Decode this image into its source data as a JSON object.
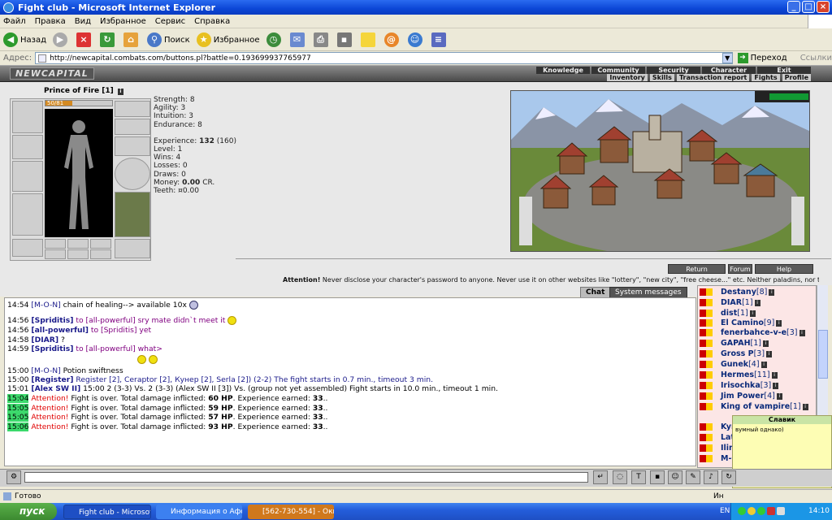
{
  "window": {
    "title": "Fight club - Microsoft Internet Explorer"
  },
  "menu": [
    "Файл",
    "Правка",
    "Вид",
    "Избранное",
    "Сервис",
    "Справка"
  ],
  "toolbar": {
    "back": "Назад",
    "search": "Поиск",
    "favorites": "Избранное"
  },
  "address": {
    "label": "Адрес:",
    "url": "http://newcapital.combats.com/buttons.pl?battle=0.193699937765977",
    "go": "Переход",
    "links": "Ссылки"
  },
  "game": {
    "brand": "NEWCAPITAL",
    "nav_top": [
      "Knowledge",
      "Community",
      "Security",
      "Character",
      "Exit"
    ],
    "nav_bottom": [
      "Inventory",
      "Skills",
      "Transaction report",
      "Fights",
      "Profile"
    ],
    "char_name": "Prince of Fire [1]",
    "hp": "50/81",
    "hp_fraction": 0.4,
    "stats": [
      {
        "label": "Strength:",
        "value": "8"
      },
      {
        "label": "Agility:",
        "value": "3"
      },
      {
        "label": "Intuition:",
        "value": "3"
      },
      {
        "label": "Endurance:",
        "value": "8"
      }
    ],
    "experience_label": "Experience:",
    "experience_value": "132",
    "experience_next": "(160)",
    "level": "Level: 1",
    "wins": "Wins: 4",
    "losses": "Losses: 0",
    "draws": "Draws: 0",
    "money_label": "Money:",
    "money_value": "0.00",
    "money_unit": "CR.",
    "teeth": "Teeth: ¤0.00",
    "buttons": {
      "return": "Return",
      "forum": "Forum",
      "help": "Help"
    },
    "attention_label": "Attention!",
    "attention_text": "Never disclose your character's password to anyone. Never use it on other websites like \"lottery\", \"new city\", \"free cheese...\" etc. Neither paladins, nor the"
  },
  "chat": {
    "tabs": [
      "Chat",
      "System messages"
    ],
    "messages": [
      {
        "time": "14:54",
        "nick": "[M-O-N]",
        "text": " chain of healing--> available 10x"
      },
      {
        "time": "14:56",
        "nick": "[Spriditis]",
        "to": " to [all-powerful]",
        "text": " sry mate didn`t meet it"
      },
      {
        "time": "14:56",
        "nick": "[all-powerful]",
        "to": " to [Spriditis]",
        "text": " yet"
      },
      {
        "time": "14:58",
        "nick": "[DIAR]",
        "text": " ?"
      },
      {
        "time": "14:59",
        "nick": "[Spriditis]",
        "to": " to [all-powerful]",
        "text": " what>"
      },
      {
        "time": "15:00",
        "nick": "[M-O-N]",
        "text": " Potion swiftness"
      },
      {
        "time": "15:00",
        "nick": "[Register]",
        "text": " Register [2], Ceraptor [2], Кунер [2], Serla [2]) (2-2) The fight starts in 0.7 min., timeout 3 min."
      },
      {
        "time": "15:01",
        "nick": "[Alex SW II]",
        "text": " 15:00 2 (3-3) Vs. 2 (3-3) (Alex SW II [3]) Vs. (group not yet assembled) Fight starts in 10.0 min., timeout 1 min."
      },
      {
        "time": "15:04",
        "alert": "Attention!",
        "text": " Fight is over. Total damage inflicted: ",
        "hp": "60 HP",
        "rest": ". Experience earned: ",
        "exp": "33",
        "end": ".."
      },
      {
        "time": "15:05",
        "alert": "Attention!",
        "text": " Fight is over. Total damage inflicted: ",
        "hp": "59 HP",
        "rest": ". Experience earned: ",
        "exp": "33",
        "end": ".."
      },
      {
        "time": "15:05",
        "alert": "Attention!",
        "text": " Fight is over. Total damage inflicted: ",
        "hp": "57 HP",
        "rest": ". Experience earned: ",
        "exp": "33",
        "end": ".."
      },
      {
        "time": "15:06",
        "alert": "Attention!",
        "text": " Fight is over. Total damage inflicted: ",
        "hp": "93 HP",
        "rest": ". Experience earned: ",
        "exp": "33",
        "end": ".."
      }
    ]
  },
  "users": [
    {
      "name": "Destany",
      "lvl": "[8]"
    },
    {
      "name": "DIAR",
      "lvl": "[1]"
    },
    {
      "name": "dist",
      "lvl": "[1]"
    },
    {
      "name": "El Camino",
      "lvl": "[9]"
    },
    {
      "name": "fenerbahce-v-e",
      "lvl": "[3]"
    },
    {
      "name": "GAPAH",
      "lvl": "[1]"
    },
    {
      "name": "Gross P",
      "lvl": "[3]"
    },
    {
      "name": "Gunek",
      "lvl": "[4]"
    },
    {
      "name": "Hermes",
      "lvl": "[11]"
    },
    {
      "name": "Irisochka",
      "lvl": "[3]"
    },
    {
      "name": "Jim Power",
      "lvl": "[4]"
    },
    {
      "name": "King of vampire",
      "lvl": "[1]"
    },
    {
      "name": "Kyn",
      "lvl": ""
    },
    {
      "name": "Lat",
      "lvl": ""
    },
    {
      "name": "Iliri",
      "lvl": ""
    },
    {
      "name": "M-O",
      "lvl": ""
    }
  ],
  "popup": {
    "title": "Славик",
    "body": "вумный однако)"
  },
  "status": {
    "text": "Готово",
    "zone": "Ин"
  },
  "taskbar": {
    "start": "пуск",
    "tasks": [
      "Fight club - Microsoft ...",
      "Информация о Афон...",
      "[562-730-554] - Окн..."
    ],
    "lang": "EN",
    "clock": "14:10"
  }
}
